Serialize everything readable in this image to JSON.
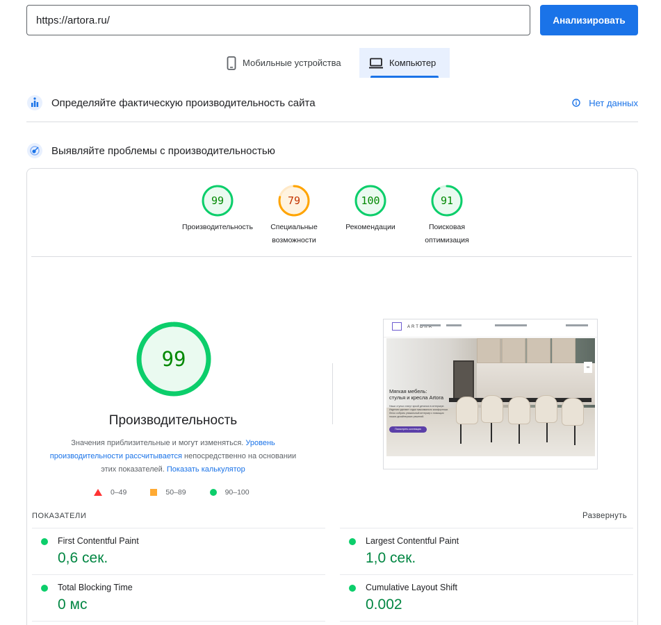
{
  "search": {
    "url": "https://artora.ru/",
    "button": "Анализировать"
  },
  "tabs": [
    {
      "label": "Мобильные устройства",
      "active": false
    },
    {
      "label": "Компьютер",
      "active": true
    }
  ],
  "field_data": {
    "title": "Определяйте фактическую производительность сайта",
    "status": "Нет данных"
  },
  "lab": {
    "title": "Выявляйте проблемы с производительностью"
  },
  "scores": [
    {
      "value": 99,
      "label_line1": "Производительность",
      "label_line2": "",
      "color": "#0cce6b",
      "text_color": "#008800"
    },
    {
      "value": 79,
      "label_line1": "Специальные",
      "label_line2": "возможности",
      "color": "#ffa400",
      "text_color": "#c33300"
    },
    {
      "value": 100,
      "label_line1": "Рекомендации",
      "label_line2": "",
      "color": "#0cce6b",
      "text_color": "#008800"
    },
    {
      "value": 91,
      "label_line1": "Поисковая",
      "label_line2": "оптимизация",
      "color": "#0cce6b",
      "text_color": "#008800"
    }
  ],
  "performance": {
    "score": 99,
    "title": "Производительность",
    "note_part1": "Значения приблизительные и могут изменяться.",
    "note_link1": "Уровень производительности рассчитывается",
    "note_part2": "непосредственно на основании этих показателей.",
    "note_link2": "Показать калькулятор"
  },
  "legend": [
    {
      "range": "0–49",
      "shape": "triangle",
      "color": "#ff3333"
    },
    {
      "range": "50–89",
      "shape": "square",
      "color": "#ffaa33"
    },
    {
      "range": "90–100",
      "shape": "circle",
      "color": "#0cce6b"
    }
  ],
  "screenshot_preview": {
    "logo": "ARTORA",
    "headline_line1": "Мягкая мебель:",
    "headline_line2": "стулья и кресла Artora",
    "body": "Наши стулья станут яркой деталью в интерьере. Изделия сделают отдых максимально комфортным. Легко собрать уникальный интерьер с помощью наших дизайнерских решений.",
    "button": "Посмотреть коллекцию",
    "side_badge": "99"
  },
  "metrics": {
    "title": "ПОКАЗАТЕЛИ",
    "expand": "Развернуть",
    "items": [
      {
        "name": "First Contentful Paint",
        "value": "0,6 сек."
      },
      {
        "name": "Largest Contentful Paint",
        "value": "1,0 сек."
      },
      {
        "name": "Total Blocking Time",
        "value": "0 мс"
      },
      {
        "name": "Cumulative Layout Shift",
        "value": "0.002"
      }
    ]
  }
}
